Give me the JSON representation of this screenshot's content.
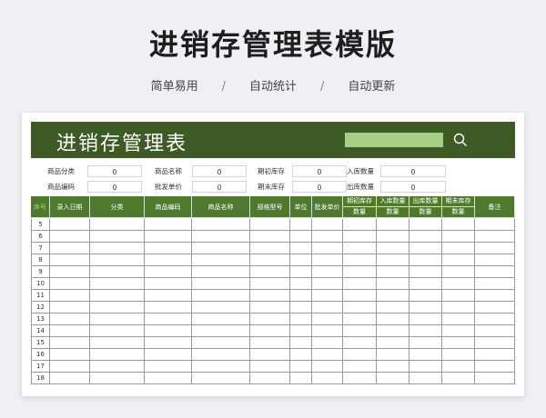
{
  "page": {
    "title": "进销存管理表模版",
    "tags": [
      "简单易用",
      "自动统计",
      "自动更新"
    ],
    "separator": "/"
  },
  "sheet": {
    "title": "进销存管理表",
    "search_value": "",
    "colors": {
      "banner": "#3e5b26",
      "header": "#4f7a2e",
      "search": "#a8cf86"
    },
    "summary": {
      "row1": [
        {
          "label": "商品分类",
          "value": "0"
        },
        {
          "label": "商品名称",
          "value": "0"
        },
        {
          "label": "期初库存",
          "value": "0"
        },
        {
          "label": "入库数量",
          "value": "0"
        }
      ],
      "row2": [
        {
          "label": "商品编码",
          "value": "0"
        },
        {
          "label": "批发单价",
          "value": "0"
        },
        {
          "label": "期末库存",
          "value": "0"
        },
        {
          "label": "出库数量",
          "value": "0"
        }
      ]
    },
    "table": {
      "headers": [
        {
          "text": "序号"
        },
        {
          "text": "录入日期"
        },
        {
          "text": "分类"
        },
        {
          "text": "商品编码"
        },
        {
          "text": "商品名称"
        },
        {
          "text": "规格型号"
        },
        {
          "text": "单位"
        },
        {
          "text": "批发单价"
        },
        {
          "line1": "期初库存",
          "line2": "数量"
        },
        {
          "line1": "入库数量",
          "line2": "数量"
        },
        {
          "line1": "出库数量",
          "line2": "数量"
        },
        {
          "line1": "期末库存",
          "line2": "数量"
        },
        {
          "text": "备注"
        }
      ],
      "row_numbers": [
        "5",
        "6",
        "7",
        "8",
        "9",
        "10",
        "11",
        "12",
        "13",
        "14",
        "15",
        "16",
        "17",
        "18"
      ]
    }
  }
}
